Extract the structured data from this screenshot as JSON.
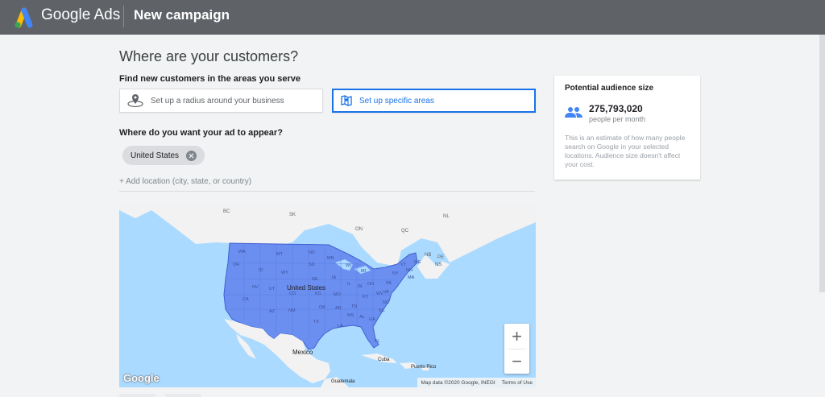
{
  "header": {
    "brand": "Google Ads",
    "title": "New campaign"
  },
  "main": {
    "heading": "Where are your customers?",
    "find_label": "Find new customers in the areas you serve",
    "options": [
      {
        "label": "Set up a radius around your business",
        "icon": "radius-pin-icon",
        "selected": false
      },
      {
        "label": "Set up specific areas",
        "icon": "map-area-icon",
        "selected": true
      }
    ],
    "appear_label": "Where do you want your ad to appear?",
    "chips": [
      {
        "label": "United States"
      }
    ],
    "add_location": "+ Add location (city, state, or country)"
  },
  "map": {
    "country_labels": [
      "United States",
      "Mexico",
      "Cuba",
      "Puerto Rico",
      "Guatemala"
    ],
    "region_labels": [
      "BC",
      "SK",
      "NL",
      "ON",
      "QC",
      "NB",
      "PE",
      "NS"
    ],
    "state_labels": [
      "WA",
      "OR",
      "CA",
      "ID",
      "NV",
      "MT",
      "WY",
      "UT",
      "AZ",
      "CO",
      "NM",
      "ND",
      "SD",
      "NE",
      "KS",
      "OK",
      "TX",
      "MN",
      "IA",
      "MO",
      "AR",
      "LA",
      "WI",
      "IL",
      "MS",
      "MI",
      "IN",
      "KY",
      "TN",
      "AL",
      "OH",
      "WV",
      "GA",
      "FL",
      "SC",
      "NC",
      "VA",
      "PA",
      "NY",
      "ME",
      "VT",
      "NH",
      "MA"
    ],
    "zoom_in": "+",
    "zoom_out": "−",
    "logo": "Google",
    "attribution": "Map data ©2020 Google, INEGI",
    "terms": "Terms of Use",
    "highlight_color": "#6b8ff0"
  },
  "audience": {
    "title": "Potential audience size",
    "value": "275,793,020",
    "unit": "people per month",
    "description": "This is an estimate of how many people search on Google in your selected locations. Audience size doesn't affect your cost."
  },
  "colors": {
    "topbar": "#5f6368",
    "accent": "#1a73e8",
    "background": "#f1f3f4"
  }
}
